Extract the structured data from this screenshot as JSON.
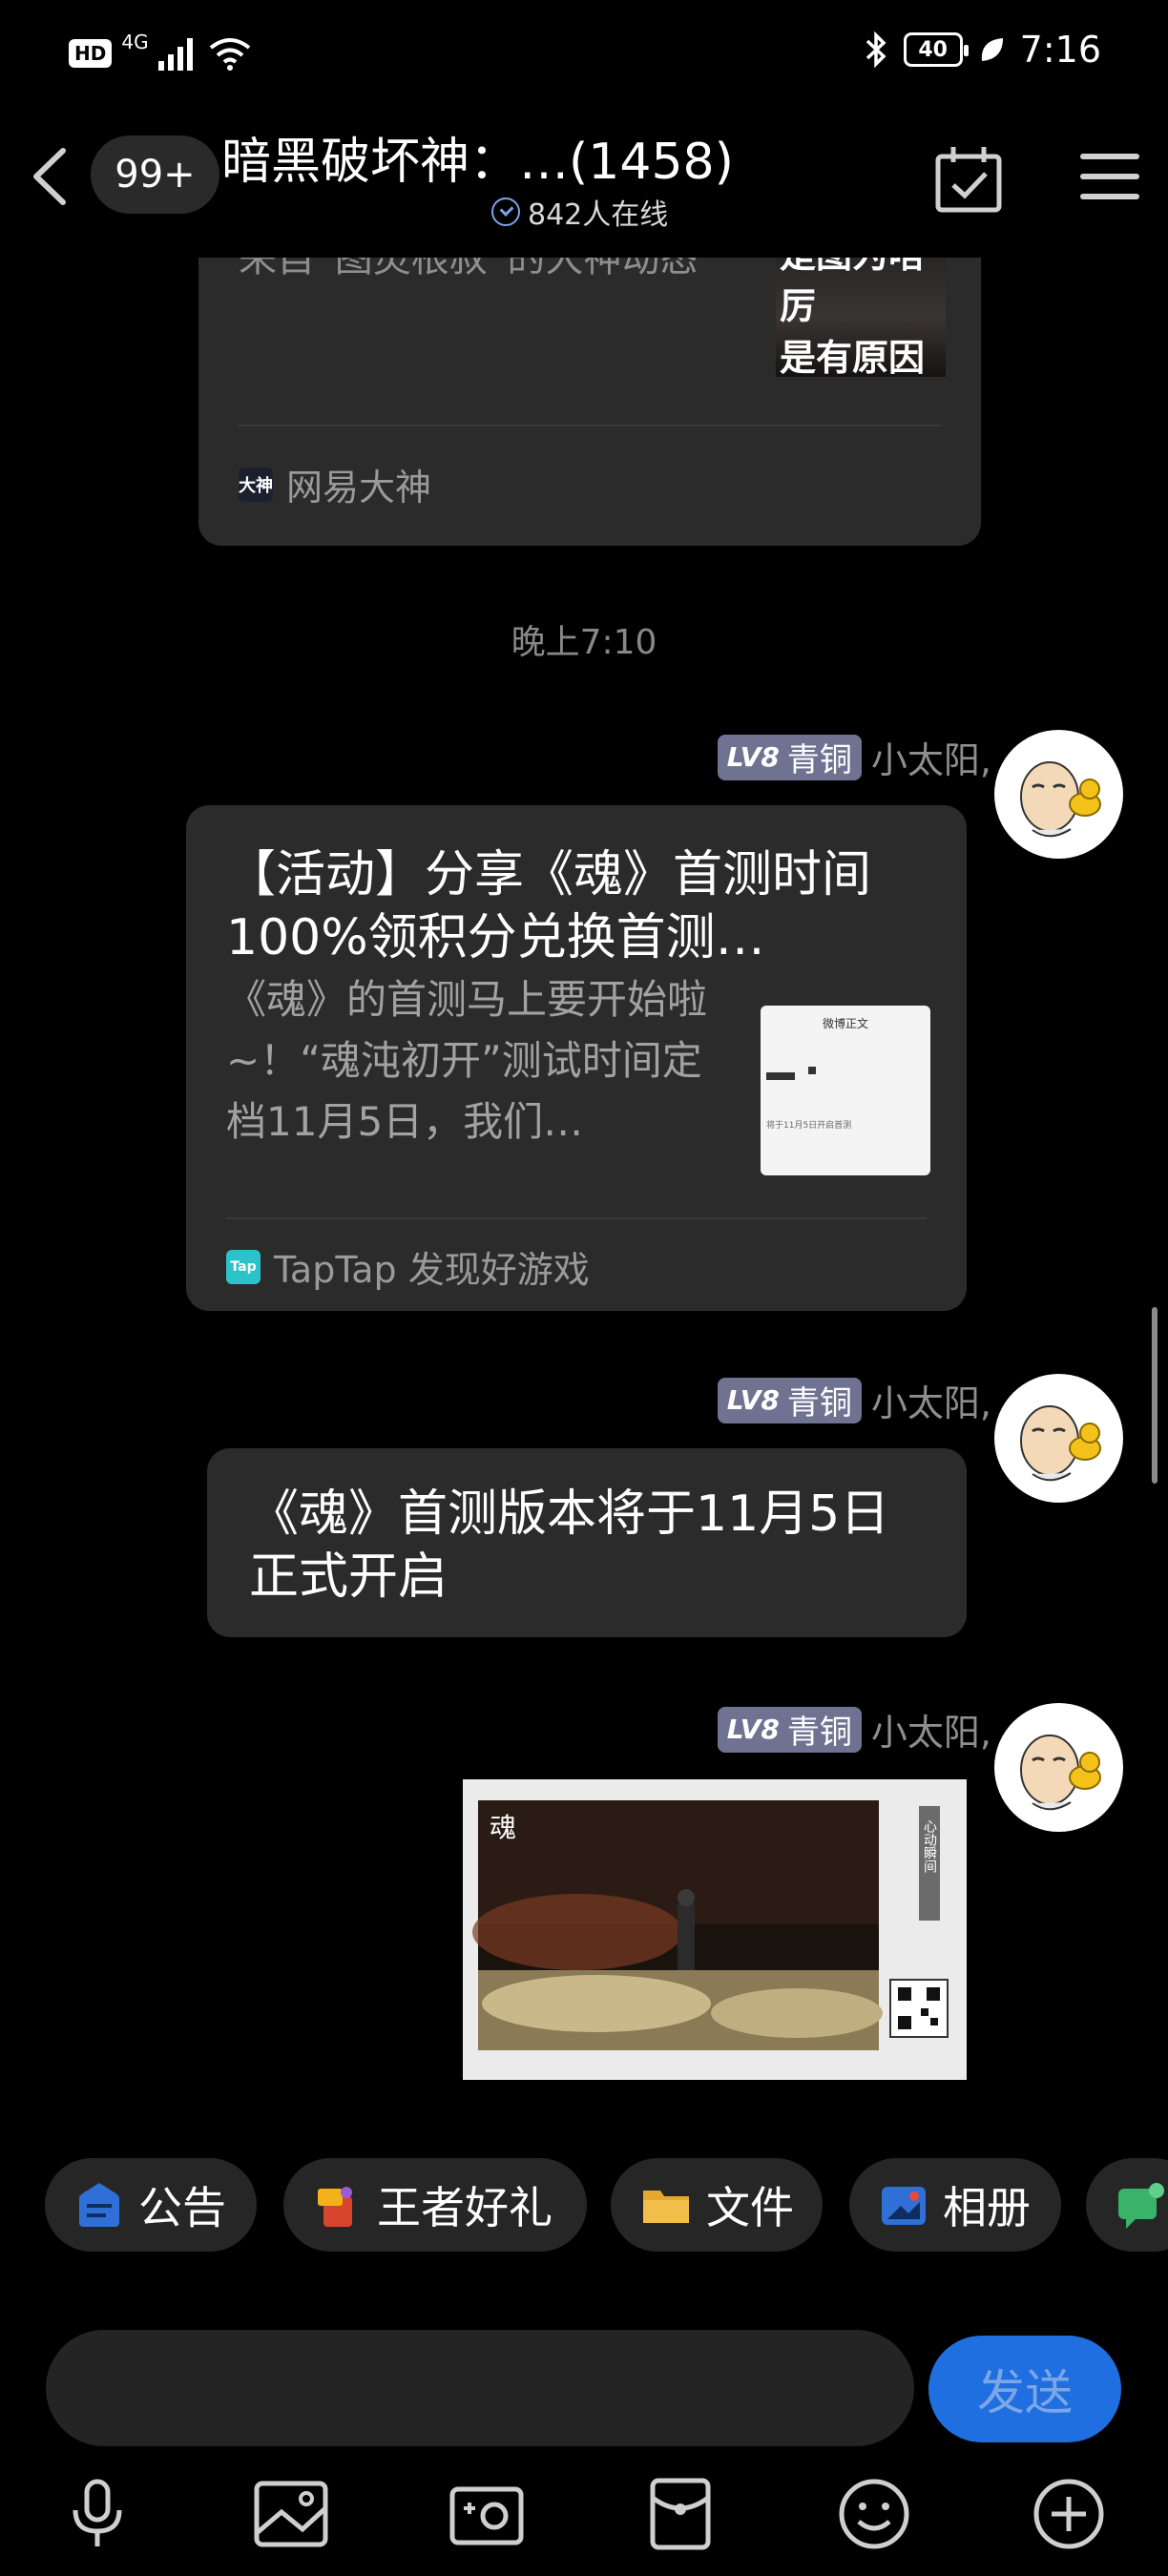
{
  "status_bar": {
    "hd": "HD",
    "network": "4G",
    "battery": "40",
    "time": "7:16"
  },
  "header": {
    "unread_badge": "99+",
    "title": "暗黑破坏神：…(1458)",
    "online": "842人在线"
  },
  "prev_card": {
    "desc": "来自“图灵根叔”的大神动态",
    "thumb_text": "是图为啥厉\n是有原因的",
    "source_logo": "大神",
    "source": "网易大神"
  },
  "time_separator": "晚上7:10",
  "sender": {
    "level": "LV8",
    "rank": "青铜",
    "name": "小太阳,"
  },
  "share_card": {
    "title": "【活动】分享《魂》首测时间 100%领积分兑换首测…",
    "desc": "《魂》的首测马上要开始啦~！“魂沌初开”测试时间定档11月5日，我们…",
    "thumb_title": "微博正文",
    "thumb_line": "将于11月5日开启首测",
    "source_logo": "Tap",
    "source": "TapTap 发现好游戏"
  },
  "text_message": "《魂》首测版本将于11月5日正式开启",
  "image_message": {
    "logo": "魂",
    "caption": "心动瞬间"
  },
  "chips": [
    {
      "label": "公告",
      "icon": "announcement-icon"
    },
    {
      "label": "王者好礼",
      "icon": "gift-icon"
    },
    {
      "label": "文件",
      "icon": "folder-icon"
    },
    {
      "label": "相册",
      "icon": "album-icon"
    }
  ],
  "input": {
    "value": "",
    "send_label": "发送"
  },
  "toolbar_icons": [
    "mic-icon",
    "image-icon",
    "camera-icon",
    "red-packet-icon",
    "emoji-icon",
    "plus-icon"
  ],
  "colors": {
    "background": "#000000",
    "bubble": "#2b2b2b",
    "send_button": "#1f6fe0",
    "level_badge": "#6f7391"
  }
}
